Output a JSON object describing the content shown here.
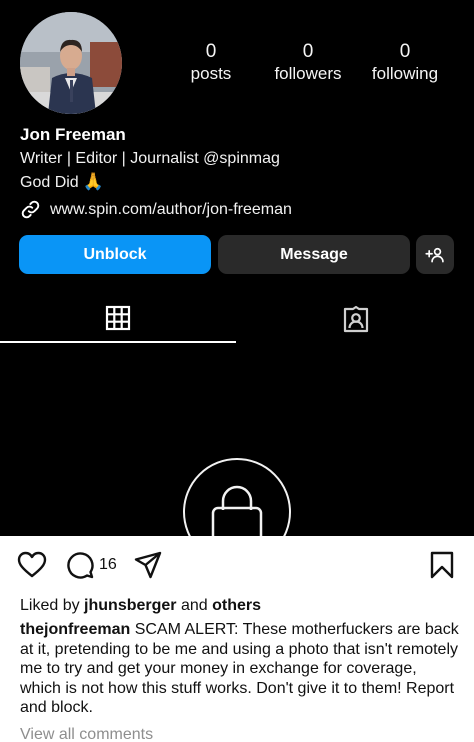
{
  "profile": {
    "name": "Jon Freeman",
    "bio_line1": "Writer | Editor | Journalist @spinmag",
    "bio_line2": "God Did",
    "bio_emoji": "🙏",
    "link": "www.spin.com/author/jon-freeman",
    "stats": {
      "posts": "0",
      "posts_label": "posts",
      "followers": "0",
      "followers_label": "followers",
      "following": "0",
      "following_label": "following"
    },
    "buttons": {
      "unblock": "Unblock",
      "message": "Message",
      "add_user_icon": "add-person-icon"
    },
    "tabs": [
      {
        "icon": "grid-icon",
        "active": true
      },
      {
        "icon": "tagged-icon",
        "active": false
      }
    ],
    "private_icon": "lock-icon",
    "colors": {
      "primary_button": "#0a95f6",
      "secondary_button": "#2a2a2a",
      "background": "#000000"
    }
  },
  "post": {
    "comment_count": "16",
    "icons": [
      "heart-icon",
      "comment-icon",
      "share-icon",
      "bookmark-icon"
    ],
    "liked_prefix": "Liked by",
    "liked_user": "jhunsberger",
    "liked_and": "and",
    "liked_others": "others",
    "caption_user": "thejonfreeman",
    "caption_text": "SCAM ALERT: These motherfuckers are back at it, pretending to be me and using a photo that isn't remotely me to try and get your money in exchange for coverage, which is not how this stuff works. Don't give it to them! Report and block.",
    "view_comments": "View all comments"
  }
}
